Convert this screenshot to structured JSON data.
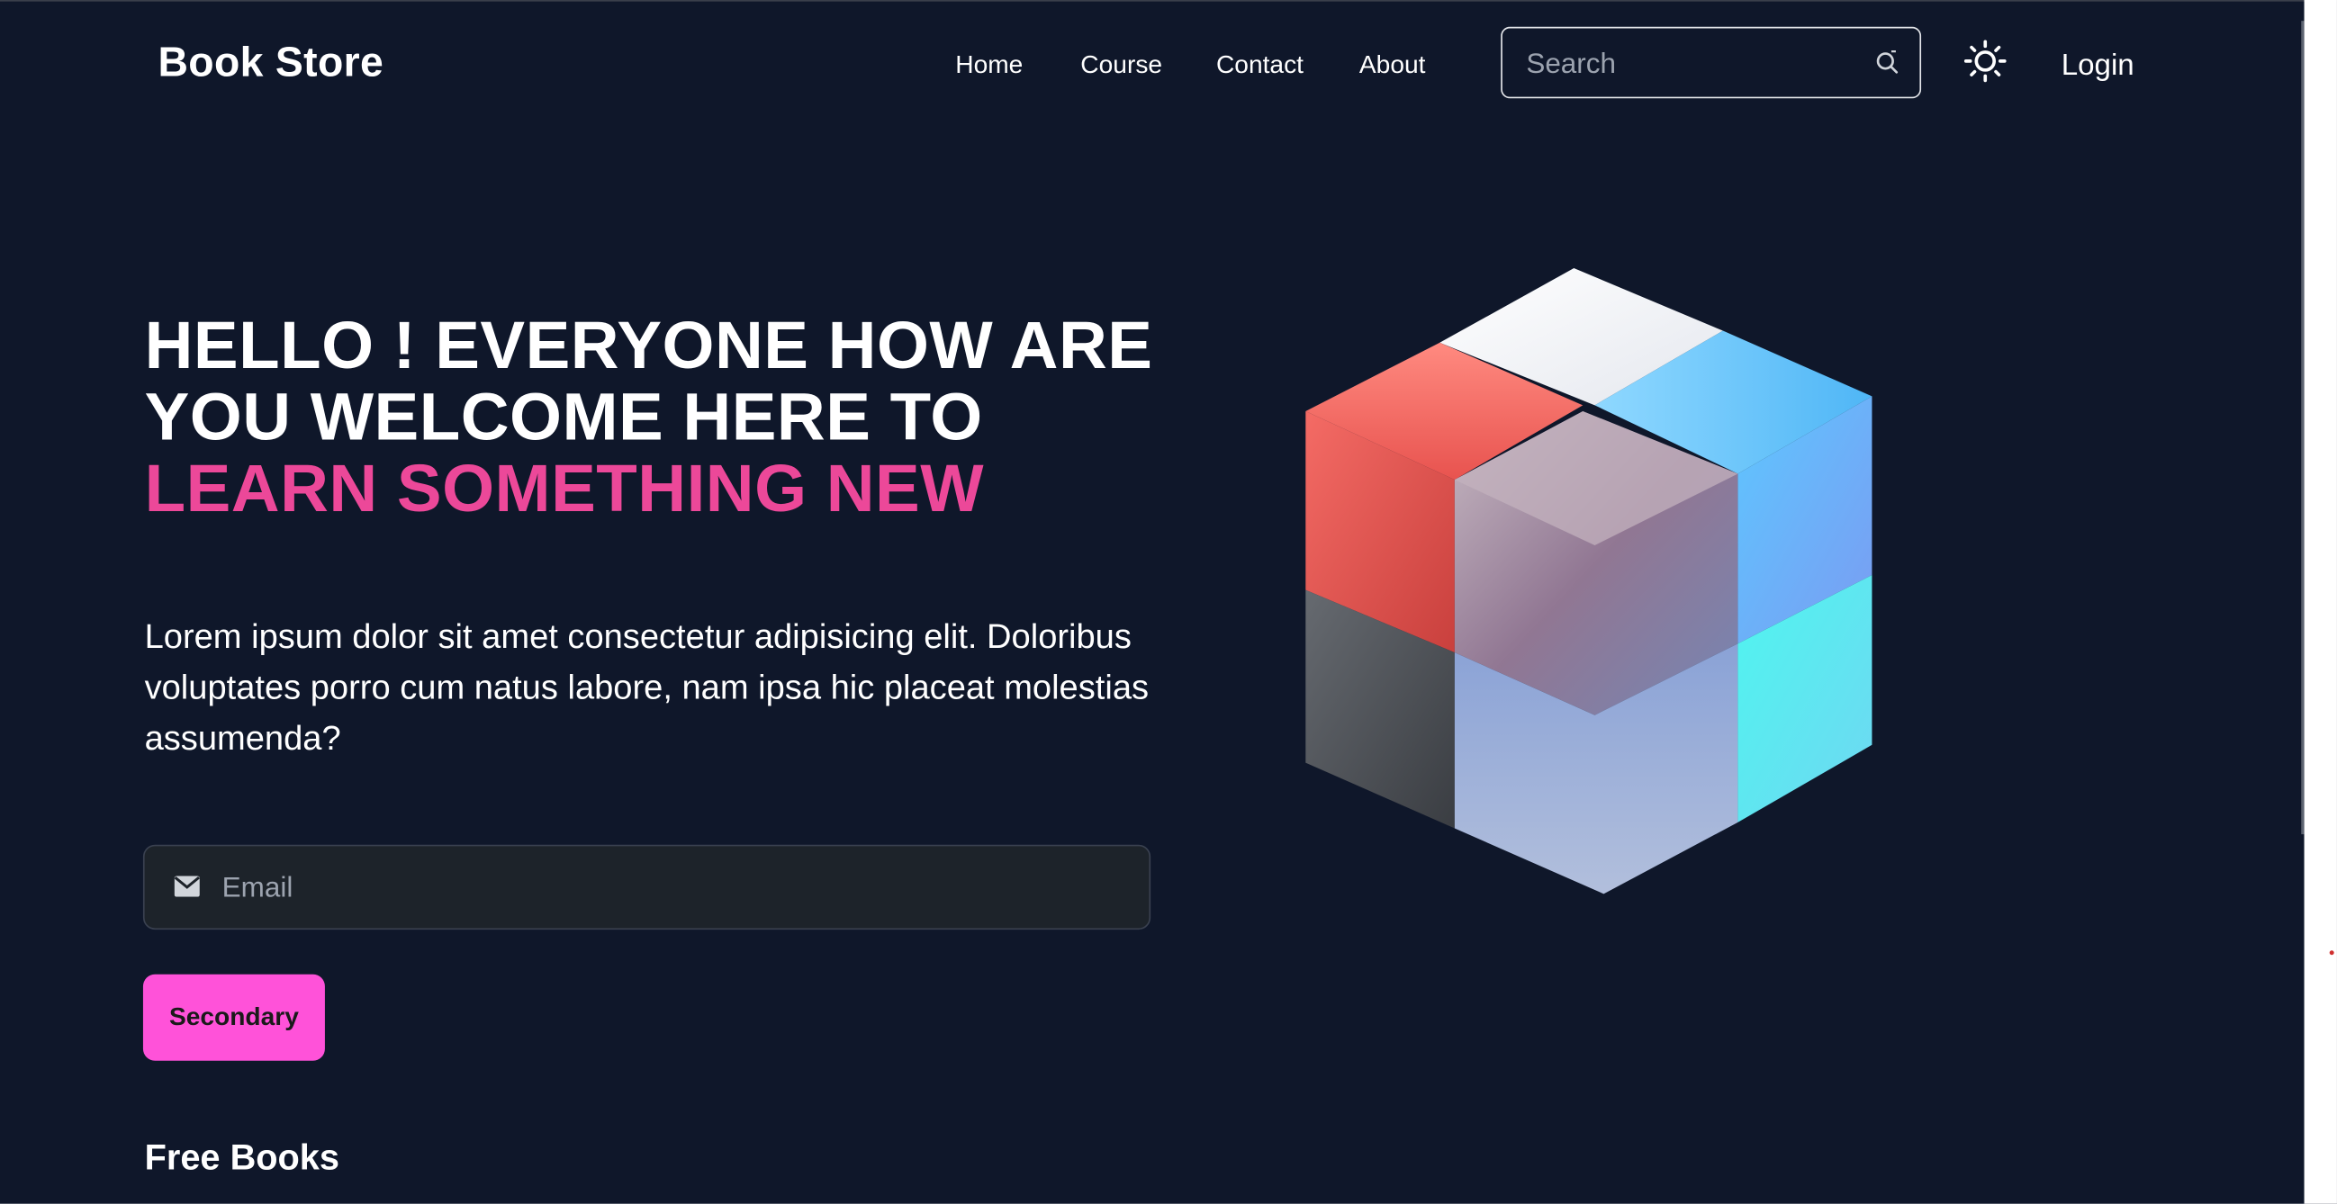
{
  "header": {
    "brand": "Book Store",
    "nav": [
      "Home",
      "Course",
      "Contact",
      "About"
    ],
    "search_placeholder": "Search",
    "login_label": "Login"
  },
  "hero": {
    "title_line1": "HELLO ! EVERYONE HOW ARE",
    "title_line2": "YOU WELCOME HERE TO",
    "title_accent": "LEARN SOMETHING NEW",
    "description": "Lorem ipsum dolor sit amet consectetur adipisicing elit. Doloribus voluptates porro cum natus labore, nam ipsa hic placeat molestias assumenda?",
    "email_placeholder": "Email",
    "button_label": "Secondary"
  },
  "section": {
    "title": "Free Books"
  },
  "icons": {
    "search": "search-icon",
    "theme": "sun-icon",
    "mail": "mail-icon"
  },
  "colors": {
    "background": "#0f172a",
    "accent": "#ec4899",
    "button": "#ff52d9",
    "input_bg": "#1d232a"
  }
}
